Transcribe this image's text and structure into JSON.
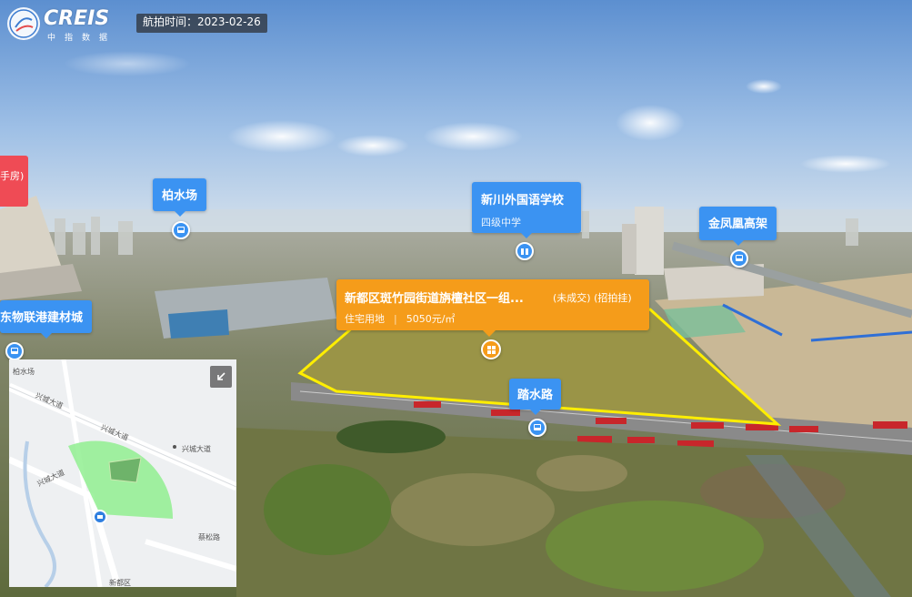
{
  "header": {
    "logo_text": "CREIS",
    "logo_sub": "中指数据",
    "capture_time": "航拍时间：2023-02-26"
  },
  "pois": {
    "left_red": "手房)",
    "bosui": "柏水场",
    "left_mall": "东物联港建材城",
    "school_name": "新川外国语学校",
    "school_type": "四级中学",
    "jinfeng": "金凤凰高架",
    "road": "踏水路"
  },
  "parcel": {
    "title": "新都区斑竹园街道旃檀社区一组...",
    "status": "(未成交) (招拍挂)",
    "land_use": "住宅用地",
    "price": "5050元/㎡"
  },
  "minimap": {
    "labels": [
      "兴城大道",
      "兴城大道",
      "兴城大道",
      "兴城大道",
      "柏水场",
      "蔡松路",
      "新都区"
    ]
  },
  "icons": {
    "bus": "bus-stop-icon",
    "camera": "camera-icon",
    "collapse": "collapse-arrow-icon",
    "building": "building-icon"
  },
  "colors": {
    "poi_blue": "#3b93f2",
    "parcel_orange": "#f59c1a",
    "parcel_outline": "#ffee00",
    "poi_red": "#ef4b55",
    "minimap_sector": "#90ee90"
  }
}
